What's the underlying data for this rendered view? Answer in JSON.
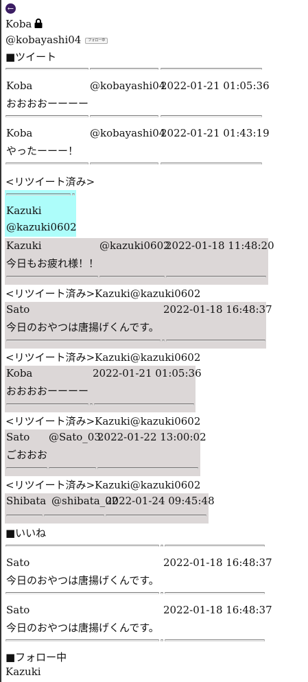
{
  "profile": {
    "name": "Koba",
    "handle": "@kobayashi04",
    "follow_button_label": "フォロー中",
    "lock_icon": "lock-icon",
    "back_icon": "back-arrow-icon"
  },
  "sections": {
    "tweets_heading": "■ツイート",
    "likes_heading": "■いいね",
    "following_heading": "■フォロー中"
  },
  "tweets": [
    {
      "name": "Koba",
      "handle": "@kobayashi04",
      "time": "2022-01-21 01:05:36",
      "text": "おおおおーーーー"
    },
    {
      "name": "Koba",
      "handle": "@kobayashi04",
      "time": "2022-01-21 01:43:19",
      "text": "やったーーー！"
    }
  ],
  "retweet_label": "<リツイート済み>",
  "retweet_user_card": {
    "name": "Kazuki",
    "handle": "@kazuki0602"
  },
  "retweets": [
    {
      "prefix": "<リツイート済み>Kazuki@kazuki0602",
      "name": "Kazuki",
      "handle": "@kazuki0602",
      "time": "2022-01-18 11:48:20",
      "text": "今日もお疲れ様！！"
    },
    {
      "prefix": "<リツイート済み>Kazuki@kazuki0602",
      "name": "Sato",
      "handle": "",
      "time": "2022-01-18 16:48:37",
      "text": "今日のおやつは唐揚げくんです。"
    },
    {
      "prefix": "<リツイート済み>Kazuki@kazuki0602",
      "name": "Koba",
      "handle": "",
      "time": "2022-01-21 01:05:36",
      "text": "おおおおーーーー"
    },
    {
      "prefix": "<リツイート済み>Kazuki@kazuki0602",
      "name": "Sato",
      "handle": "@Sato_03",
      "time": "2022-01-22 13:00:02",
      "text": "ごおおお"
    },
    {
      "prefix": "<リツイート済み>Kazuki@kazuki0602",
      "name": "Shibata",
      "handle": "@shibata_02",
      "time": "2022-01-24 09:45:48",
      "text": ""
    }
  ],
  "likes": [
    {
      "name": "Sato",
      "time": "2022-01-18 16:48:37",
      "text": "今日のおやつは唐揚げくんです。"
    },
    {
      "name": "Sato",
      "time": "2022-01-18 16:48:37",
      "text": "今日のおやつは唐揚げくんです。"
    }
  ],
  "following": [
    {
      "name": "Kazuki"
    }
  ]
}
